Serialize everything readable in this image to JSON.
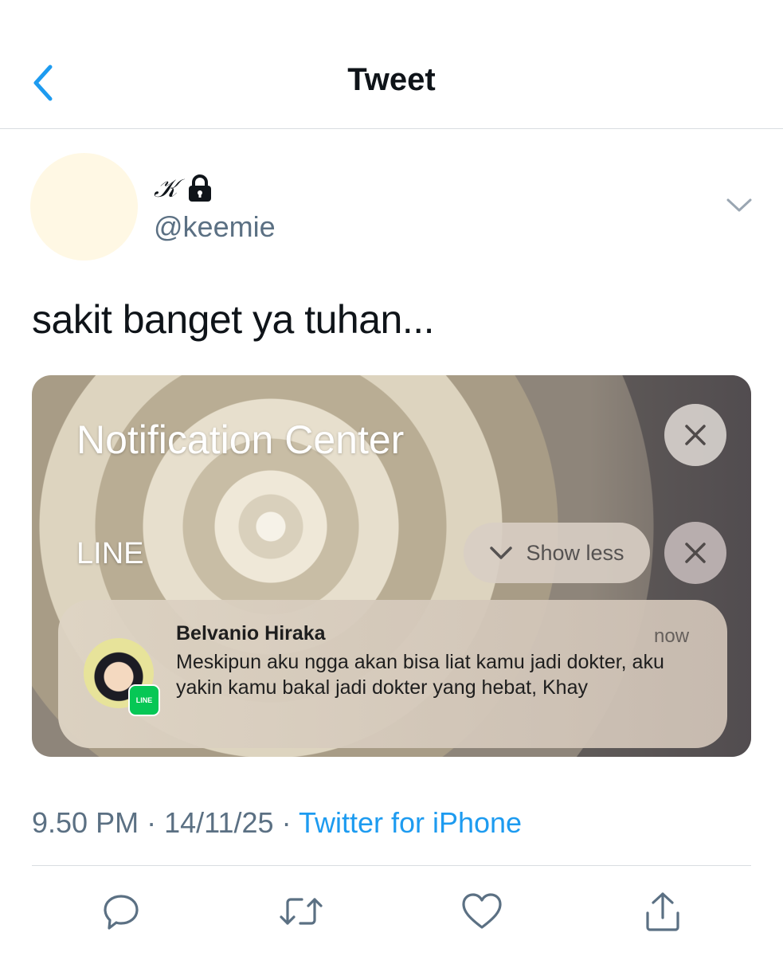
{
  "header": {
    "title": "Tweet"
  },
  "author": {
    "display_name": "𝒦",
    "handle": "@keemie"
  },
  "tweet": {
    "text": "sakit banget ya tuhan..."
  },
  "media": {
    "notification_center_title": "Notification Center",
    "group_label": "LINE",
    "show_less_label": "Show less",
    "notification": {
      "sender": "Belvanio Hiraka",
      "time": "now",
      "body": "Meskipun aku ngga akan bisa liat kamu jadi dokter, aku yakin kamu bakal jadi dokter yang hebat, Khay",
      "app_badge": "LINE"
    }
  },
  "meta": {
    "time": "9.50 PM",
    "separator": "·",
    "date": "14/11/25",
    "source": "Twitter for iPhone"
  },
  "actions": [
    "reply-icon",
    "retweet-icon",
    "like-icon",
    "share-icon"
  ],
  "colors": {
    "accent": "#1d9bf0",
    "secondary_text": "#5b7083",
    "line_green": "#06c755"
  }
}
